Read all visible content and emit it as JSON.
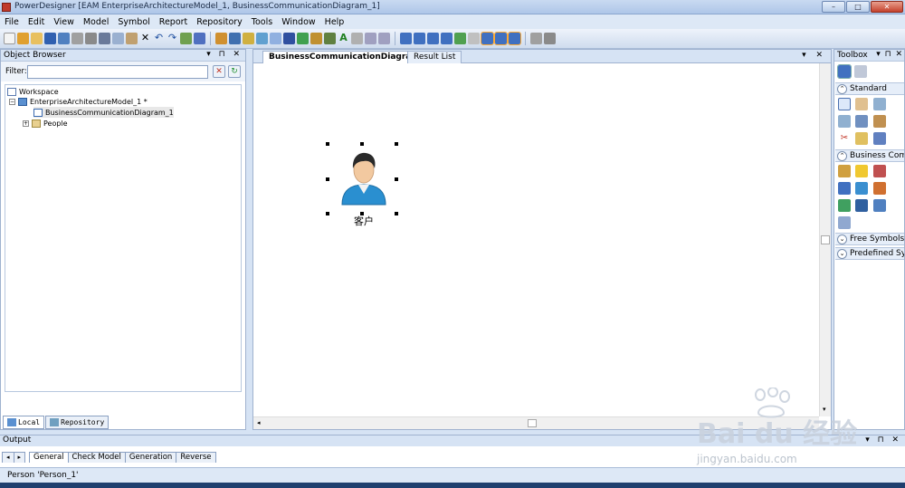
{
  "window": {
    "title": "PowerDesigner [EAM EnterpriseArchitectureModel_1, BusinessCommunicationDiagram_1]",
    "controls": [
      "–",
      "□",
      "✕"
    ]
  },
  "menu": [
    "File",
    "Edit",
    "View",
    "Model",
    "Symbol",
    "Report",
    "Repository",
    "Tools",
    "Window",
    "Help"
  ],
  "object_browser": {
    "title": "Object Browser",
    "header_buttons": "▾ ⊓ ✕",
    "filter_label": "Filter:",
    "filter_value": "",
    "tree": [
      {
        "label": "Workspace",
        "level": 0
      },
      {
        "label": "EnterpriseArchitectureModel_1 *",
        "level": 1
      },
      {
        "label": "BusinessCommunicationDiagram_1",
        "level": 2
      },
      {
        "label": "People",
        "level": 2
      }
    ],
    "tabs": [
      "Local",
      "Repository"
    ]
  },
  "diagram": {
    "tabs": [
      "BusinessCommunicationDiagra...",
      "Result List"
    ],
    "header_buttons": "▾ ✕",
    "person_label": "客户"
  },
  "toolbox": {
    "title": "Toolbox",
    "header_buttons": "▾ ⊓ ✕",
    "sections": [
      "Standard",
      "Business Com",
      "Free Symbols",
      "Predefined Sy"
    ]
  },
  "output": {
    "title": "Output",
    "header_buttons": "▾ ⊓ ✕",
    "tabs": [
      "General",
      "Check Model",
      "Generation",
      "Reverse"
    ]
  },
  "status": {
    "text": "Person 'Person_1'"
  },
  "watermark": {
    "brand": "Bai du 经验",
    "url": "jingyan.baidu.com"
  },
  "colors": {
    "accent": "#2a8fd0",
    "chrome": "#d6e3f4",
    "close": "#c4412c"
  }
}
